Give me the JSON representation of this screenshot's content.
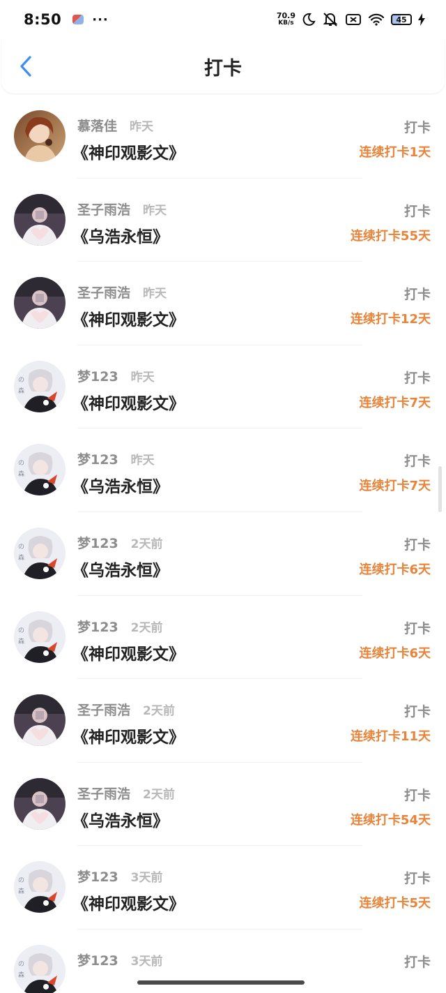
{
  "status_bar": {
    "time": "8:50",
    "dots": "···",
    "net_speed_value": "70.9",
    "net_speed_unit": "KB/s",
    "battery": "45"
  },
  "header": {
    "title": "打卡"
  },
  "checkins": [
    {
      "user": "慕落佳",
      "time": "昨天",
      "book": "《神印观影文》",
      "action": "打卡",
      "streak": "连续打卡1天",
      "avatar": "avatar-a"
    },
    {
      "user": "圣子雨浩",
      "time": "昨天",
      "book": "《乌浩永恒》",
      "action": "打卡",
      "streak": "连续打卡55天",
      "avatar": "avatar-b"
    },
    {
      "user": "圣子雨浩",
      "time": "昨天",
      "book": "《神印观影文》",
      "action": "打卡",
      "streak": "连续打卡12天",
      "avatar": "avatar-b"
    },
    {
      "user": "梦123",
      "time": "昨天",
      "book": "《神印观影文》",
      "action": "打卡",
      "streak": "连续打卡7天",
      "avatar": "avatar-c"
    },
    {
      "user": "梦123",
      "time": "昨天",
      "book": "《乌浩永恒》",
      "action": "打卡",
      "streak": "连续打卡7天",
      "avatar": "avatar-c"
    },
    {
      "user": "梦123",
      "time": "2天前",
      "book": "《乌浩永恒》",
      "action": "打卡",
      "streak": "连续打卡6天",
      "avatar": "avatar-c"
    },
    {
      "user": "梦123",
      "time": "2天前",
      "book": "《神印观影文》",
      "action": "打卡",
      "streak": "连续打卡6天",
      "avatar": "avatar-c"
    },
    {
      "user": "圣子雨浩",
      "time": "2天前",
      "book": "《神印观影文》",
      "action": "打卡",
      "streak": "连续打卡11天",
      "avatar": "avatar-b"
    },
    {
      "user": "圣子雨浩",
      "time": "2天前",
      "book": "《乌浩永恒》",
      "action": "打卡",
      "streak": "连续打卡54天",
      "avatar": "avatar-b"
    },
    {
      "user": "梦123",
      "time": "3天前",
      "book": "《神印观影文》",
      "action": "打卡",
      "streak": "连续打卡5天",
      "avatar": "avatar-c"
    },
    {
      "user": "梦123",
      "time": "3天前",
      "book": "",
      "action": "打卡",
      "streak": "",
      "avatar": "avatar-c"
    }
  ],
  "colors": {
    "streak": "#e8843a",
    "back_arrow": "#3d8ef0",
    "muted_text": "#8c8c8c"
  },
  "icons": [
    "back-arrow-icon",
    "moon-icon",
    "mute-icon",
    "sim-off-icon",
    "wifi-icon",
    "battery-icon",
    "charging-icon"
  ]
}
